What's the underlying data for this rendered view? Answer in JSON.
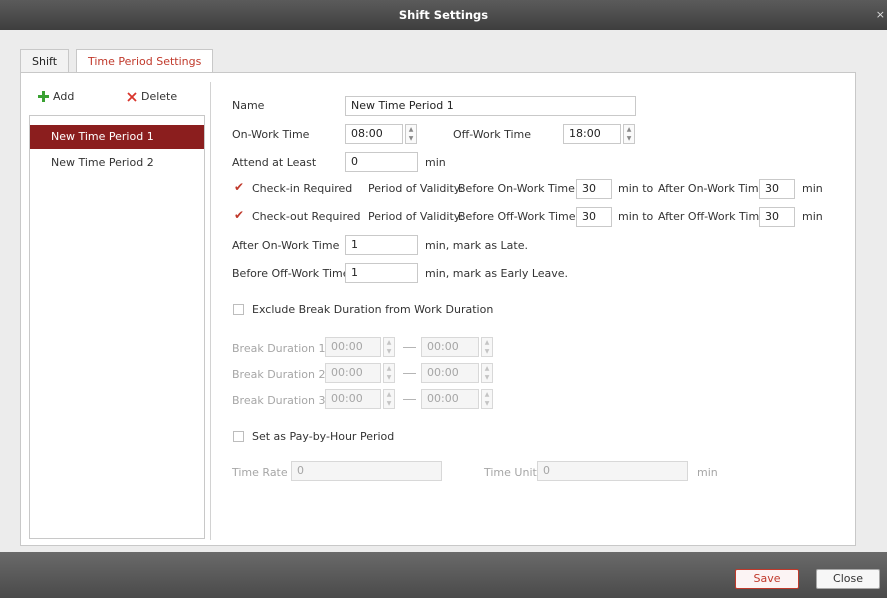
{
  "window": {
    "title": "Shift Settings",
    "close_symbol": "×"
  },
  "tabs": [
    {
      "label": "Shift",
      "active": false
    },
    {
      "label": "Time Period Settings",
      "active": true
    }
  ],
  "toolbar": {
    "add_label": "Add",
    "delete_label": "Delete",
    "add_icon": "plus-icon",
    "delete_icon": "x-icon"
  },
  "periods": [
    "New Time Period 1",
    "New Time Period 2"
  ],
  "form": {
    "name_label": "Name",
    "name_value": "New Time Period 1",
    "on_work_label": "On-Work Time",
    "on_work_value": "08:00",
    "off_work_label": "Off-Work Time",
    "off_work_value": "18:00",
    "attend_label": "Attend at Least",
    "attend_value": "0",
    "attend_unit": "min",
    "checkin": {
      "label": "Check-in Required",
      "checked": true,
      "validity_label": "Period of Validity:",
      "before_label": "Before On-Work Time",
      "before_value": "30",
      "min_to": "min  to",
      "after_label": "After On-Work Time",
      "after_value": "30",
      "unit": "min"
    },
    "checkout": {
      "label": "Check-out Required",
      "checked": true,
      "validity_label": "Period of Validity:",
      "before_label": "Before Off-Work Time",
      "before_value": "30",
      "min_to": "min  to",
      "after_label": "After Off-Work Time",
      "after_value": "30",
      "unit": "min"
    },
    "late_label": "After On-Work Time",
    "late_value": "1",
    "late_suffix": "min,  mark as Late.",
    "early_label": "Before Off-Work Time",
    "early_value": "1",
    "early_suffix": "min,  mark as Early Leave.",
    "exclude_break_label": "Exclude Break Duration from Work Duration",
    "exclude_break_checked": false,
    "breaks": [
      {
        "label": "Break Duration  1",
        "start": "00:00",
        "end": "00:00"
      },
      {
        "label": "Break Duration  2",
        "start": "00:00",
        "end": "00:00"
      },
      {
        "label": "Break Duration  3",
        "start": "00:00",
        "end": "00:00"
      }
    ],
    "pay_by_hour_label": "Set as Pay-by-Hour Period",
    "pay_by_hour_checked": false,
    "time_rate_label": "Time Rate",
    "time_rate_value": "0",
    "time_unit_label": "Time Unit",
    "time_unit_value": "0",
    "time_unit_suffix": "min"
  },
  "footer": {
    "save_label": "Save",
    "close_label": "Close"
  },
  "colors": {
    "accent": "#c0392b",
    "selected_row": "#8b1e1e",
    "add_icon": "#3aa132"
  }
}
